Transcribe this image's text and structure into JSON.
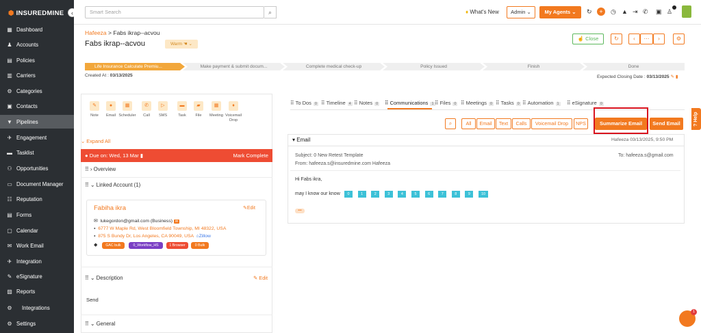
{
  "app": {
    "brand": "INSUREDMINE",
    "collapse_icon": "‹"
  },
  "sidebar": {
    "items": [
      {
        "label": "Dashboard",
        "icon": "▦"
      },
      {
        "label": "Accounts",
        "icon": "♟"
      },
      {
        "label": "Policies",
        "icon": "▤"
      },
      {
        "label": "Carriers",
        "icon": "▥"
      },
      {
        "label": "Categories",
        "icon": "⚙"
      },
      {
        "label": "Contacts",
        "icon": "▣"
      },
      {
        "label": "Pipelines",
        "icon": "▼"
      },
      {
        "label": "Engagement",
        "icon": "✈"
      },
      {
        "label": "Tasklist",
        "icon": "▬"
      },
      {
        "label": "Opportunities",
        "icon": "⚇"
      },
      {
        "label": "Document Manager",
        "icon": "▭"
      },
      {
        "label": "Reputation",
        "icon": "☷"
      },
      {
        "label": "Forms",
        "icon": "▤"
      },
      {
        "label": "Calendar",
        "icon": "▢"
      },
      {
        "label": "Work Email",
        "icon": "✉"
      },
      {
        "label": "Integration",
        "icon": "✈"
      },
      {
        "label": "eSignature",
        "icon": "✎"
      },
      {
        "label": "Reports",
        "icon": "▨"
      },
      {
        "label": "Integrations",
        "icon": "⚙"
      },
      {
        "label": "Settings",
        "icon": "⚙"
      }
    ],
    "active": "Pipelines"
  },
  "topbar": {
    "search_placeholder": "Smart Search",
    "whats_new": "What's New",
    "admin": "Admin",
    "my_agents": "My Agents"
  },
  "header": {
    "breadcrumb_link": "Hafeeza",
    "breadcrumb_sep": ">",
    "breadcrumb_current": "Fabs ikrap--acvou",
    "title": "Fabs ikrap--acvou",
    "warm_badge": "Warm",
    "close_label": "Close",
    "more_label": "⋯"
  },
  "pipeline": {
    "stages": [
      "Life Insurance Calculate Premiu...",
      "Make payment & submit docum...",
      "Complete medical check-up",
      "Policy Issued",
      "Finish",
      "Done"
    ],
    "created_label": "Created At :",
    "created_value": "03/13/2025",
    "closing_label": "Expected Closing Date :",
    "closing_value": "03/13/2025"
  },
  "actions": [
    {
      "label": "Note",
      "icon": "✎"
    },
    {
      "label": "Email",
      "icon": "●"
    },
    {
      "label": "Scheduler",
      "icon": "▦"
    },
    {
      "label": "Call",
      "icon": "✆"
    },
    {
      "label": "SMS",
      "icon": "▷"
    },
    {
      "label": "Task",
      "icon": "▬"
    },
    {
      "label": "File",
      "icon": "▰"
    },
    {
      "label": "Meeting",
      "icon": "▦"
    },
    {
      "label": "Voicemail Drop",
      "icon": "♦"
    }
  ],
  "left": {
    "expand_all": "Expand All",
    "due_label": "Due on: Wed, 13 Mar",
    "mark_complete": "Mark Complete",
    "overview": "Overview",
    "linked_account": "Linked Account (1)",
    "account": {
      "name": "Fabiha ikra",
      "edit": "Edit",
      "email": "lukegordon@gmail.com (Business)",
      "address1": "6777 W Maple Rd, West Bloomfield Township, MI 48322, USA",
      "address2": "875 S Bundy Dr, Los Angeles, CA 90049, USA",
      "zillow": "Zillow",
      "tags": [
        {
          "label": "GAC bulk",
          "color": "#f2791f"
        },
        {
          "label": "0_Workflow_HS",
          "color": "#7a3fc4"
        },
        {
          "label": "1 Browser",
          "color": "#ee4c33"
        },
        {
          "label": "0 Bulk",
          "color": "#f2791f"
        }
      ]
    },
    "description_label": "Description",
    "description_edit": "Edit",
    "description_text": "Send",
    "general_label": "General"
  },
  "tabs": [
    {
      "label": "To Dos",
      "count": "0"
    },
    {
      "label": "Timeline",
      "count": "4"
    },
    {
      "label": "Notes",
      "count": "0"
    },
    {
      "label": "Communications",
      "count": "1"
    },
    {
      "label": "Files",
      "count": "0"
    },
    {
      "label": "Meetings",
      "count": "0"
    },
    {
      "label": "Tasks",
      "count": "0"
    },
    {
      "label": "Automation",
      "count": "1"
    },
    {
      "label": "eSignature",
      "count": "0"
    }
  ],
  "filters": [
    "All",
    "Email",
    "Text",
    "Calls",
    "Voicemail Drop",
    "NPS"
  ],
  "buttons": {
    "summarize": "Summarize Email",
    "send": "Send Email"
  },
  "email": {
    "heading": "Email",
    "meta": "Hafeeza 03/13/2025, 9:50 PM",
    "subject": "Subject: 0 New Retest Template",
    "from": "From: hafeeza.s@insuredmine.com Hafeeza",
    "to": "To: hafeeza.s@gmail.com",
    "greeting": "Hi Fabs ikra,",
    "question": "may I know our know",
    "numbers": [
      "0",
      "1",
      "2",
      "3",
      "4",
      "5",
      "6",
      "7",
      "8",
      "9",
      "10"
    ],
    "more": "•••"
  },
  "help_label": "Help",
  "chat_badge": "1"
}
